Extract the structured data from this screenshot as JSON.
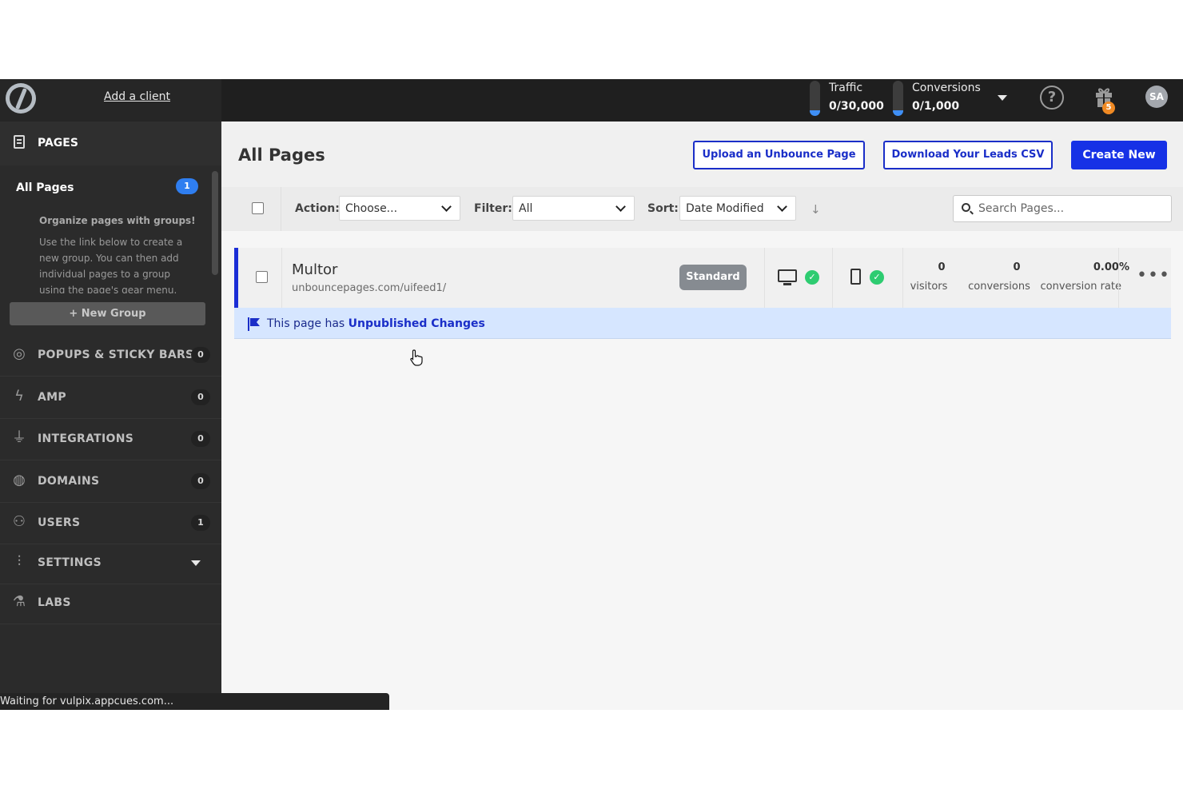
{
  "topbar": {
    "add_client": "Add a client",
    "traffic": {
      "label": "Traffic",
      "value": "0/30,000",
      "fill_fraction": 0.15
    },
    "conversions": {
      "label": "Conversions",
      "value": "0/1,000",
      "fill_fraction": 0.15
    },
    "help_icon": "?",
    "gift_badge": "5",
    "avatar_initials": "SA",
    "meter_color": "#3f8ff5"
  },
  "sidebar": {
    "pages_label": "PAGES",
    "all_pages": {
      "label": "All Pages",
      "count": "1"
    },
    "tip_title": "Organize pages with groups!",
    "tip_body": "Use the link below to create a new group. You can then add individual pages to a group using the page's gear menu.",
    "new_group": "+ New Group",
    "items": [
      {
        "label": "POPUPS & STICKY BARS",
        "count": "0",
        "icon": "target-icon"
      },
      {
        "label": "AMP",
        "count": "0",
        "icon": "lightning-icon"
      },
      {
        "label": "INTEGRATIONS",
        "count": "0",
        "icon": "plug-icon"
      },
      {
        "label": "DOMAINS",
        "count": "0",
        "icon": "globe-icon"
      },
      {
        "label": "USERS",
        "count": "1",
        "icon": "users-icon"
      },
      {
        "label": "SETTINGS",
        "count": "",
        "icon": "sliders-icon"
      },
      {
        "label": "LABS",
        "count": "",
        "icon": "flask-icon"
      }
    ]
  },
  "main": {
    "title": "All Pages",
    "upload_button": "Upload an Unbounce Page",
    "download_button": "Download Your Leads CSV",
    "create_button": "Create New",
    "toolbar": {
      "action_label": "Action:",
      "action_value": "Choose...",
      "filter_label": "Filter:",
      "filter_value": "All",
      "sort_label": "Sort:",
      "sort_value": "Date Modified",
      "search_placeholder": "Search Pages..."
    },
    "page": {
      "name": "Multor",
      "url": "unbouncepages.com/uifeed1/",
      "type": "Standard",
      "visitors": "0",
      "visitors_label": "visitors",
      "conversions": "0",
      "conversions_label": "conversions",
      "rate": "0.00%",
      "rate_label": "conversion rate"
    },
    "banner": {
      "prefix": "This page has ",
      "emphasis": "Unpublished Changes"
    }
  },
  "statusbar": "Waiting for vulpix.appcues.com...",
  "colors": {
    "accent": "#1631e6",
    "success": "#2ecc71",
    "banner_bg": "#d6e6ff"
  }
}
